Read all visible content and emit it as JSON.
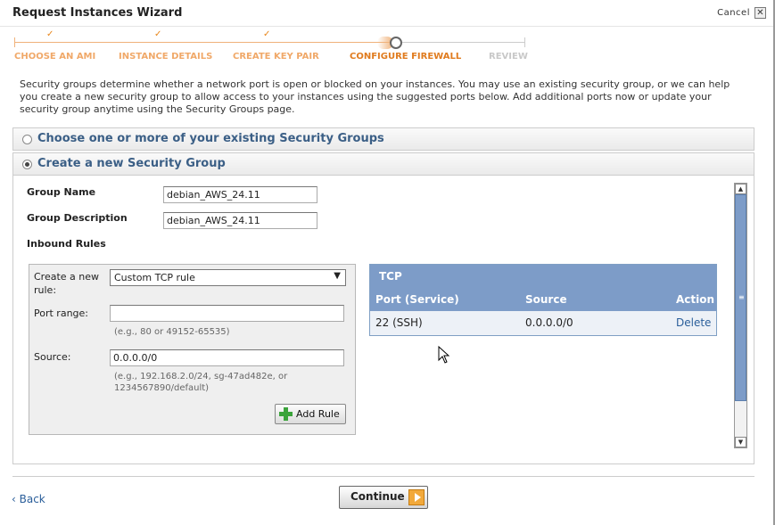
{
  "window": {
    "title": "Request Instances Wizard",
    "cancel_label": "Cancel",
    "close_glyph": "✕"
  },
  "steps": [
    {
      "label": "CHOOSE AN AMI",
      "state": "done"
    },
    {
      "label": "INSTANCE DETAILS",
      "state": "done"
    },
    {
      "label": "CREATE KEY PAIR",
      "state": "done"
    },
    {
      "label": "CONFIGURE FIREWALL",
      "state": "current"
    },
    {
      "label": "REVIEW",
      "state": "todo"
    }
  ],
  "check_glyph": "✓",
  "intro": "Security groups determine whether a network port is open or blocked on your instances. You may use an existing security group, or we can help you create a new security group to allow access to your instances using the suggested ports below. Add additional ports now or update your security group anytime using the Security Groups page.",
  "options": {
    "existing": {
      "label": "Choose one or more of your existing Security Groups",
      "selected": false
    },
    "new": {
      "label": "Create a new Security Group",
      "selected": true
    }
  },
  "form": {
    "group_name_label": "Group Name",
    "group_name_value": "debian_AWS_24.11",
    "group_desc_label": "Group Description",
    "group_desc_value": "debian_AWS_24.11",
    "inbound_label": "Inbound Rules"
  },
  "rule": {
    "create_label": "Create a new rule:",
    "rule_type": "Custom TCP rule",
    "select_arrow": "▼",
    "port_label": "Port range:",
    "port_value": "",
    "port_hint": "(e.g., 80 or 49152-65535)",
    "source_label": "Source:",
    "source_value": "0.0.0.0/0",
    "source_hint": "(e.g., 192.168.2.0/24, sg-47ad482e, or 1234567890/default)",
    "add_label": "Add Rule"
  },
  "tcp_table": {
    "title": "TCP",
    "columns": [
      "Port (Service)",
      "Source",
      "Action"
    ],
    "rows": [
      {
        "port": "22 (SSH)",
        "source": "0.0.0.0/0",
        "action": "Delete"
      }
    ]
  },
  "scrollbar": {
    "up": "▲",
    "down": "▼",
    "grip": "≡"
  },
  "footer": {
    "back_label": "‹ Back",
    "continue_label": "Continue"
  },
  "colors": {
    "step_done": "#f0a868",
    "step_current": "#e07b1e",
    "step_todo": "#c8c8c8",
    "link": "#2a5e9a",
    "table_header": "#7d9cc8"
  }
}
